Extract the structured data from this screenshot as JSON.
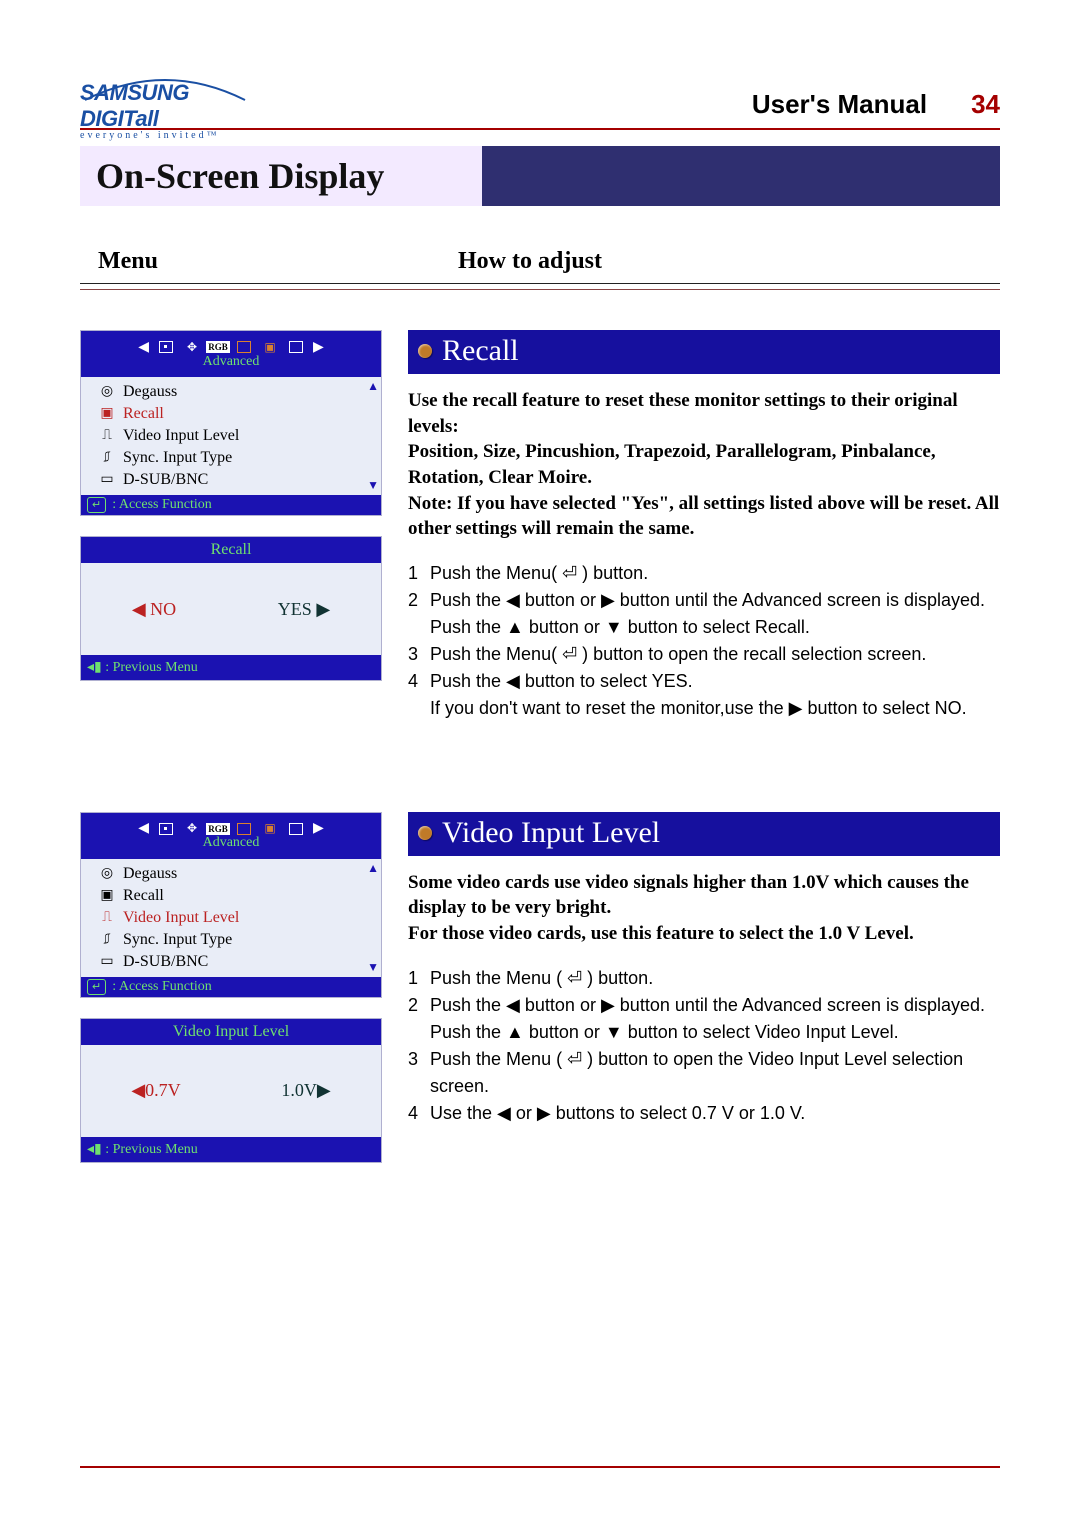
{
  "header": {
    "logo_main": "SAMSUNG DIGITall",
    "logo_tag": "everyone's invited™",
    "manual": "User's Manual",
    "page_no": "34"
  },
  "title": "On-Screen Display",
  "colheads": {
    "menu": "Menu",
    "howto": "How to adjust"
  },
  "osd_advanced_label": "Advanced",
  "osd_access_label": ": Access Function",
  "osd_prev_label": ": Previous Menu",
  "osd_items": [
    {
      "label": "Degauss"
    },
    {
      "label": "Recall"
    },
    {
      "label": "Video Input Level"
    },
    {
      "label": "Sync. Input Type"
    },
    {
      "label": "D-SUB/BNC"
    }
  ],
  "section1": {
    "heading": "Recall",
    "osd_selected_index": 1,
    "popup_title": "Recall",
    "popup_left": "NO",
    "popup_right": "YES",
    "desc_lines": [
      "Use the recall feature to reset these monitor settings to their original levels:",
      "Position, Size, Pincushion, Trapezoid, Parallelogram, Pinbalance, Rotation, Clear Moire.",
      "Note: If you have selected \"Yes\", all settings listed above will be reset. All other settings will remain the same."
    ],
    "steps": [
      {
        "n": "1",
        "t": "Push the Menu( ⏎ ) button."
      },
      {
        "n": "2",
        "t": "Push the ◀ button or ▶ button until the Advanced screen is displayed."
      },
      {
        "n": "",
        "t": "Push the ▲ button or ▼ button to select Recall."
      },
      {
        "n": "3",
        "t": "Push the Menu( ⏎ ) button to open the recall selection screen."
      },
      {
        "n": "4",
        "t": "Push the ◀ button to select YES."
      },
      {
        "n": "",
        "t": "If you don't want to reset the monitor,use the ▶ button to select NO."
      }
    ]
  },
  "section2": {
    "heading": "Video Input Level",
    "osd_selected_index": 2,
    "popup_title": "Video Input Level",
    "popup_left": "0.7V",
    "popup_right": "1.0V",
    "desc_lines": [
      "Some video cards use video signals higher than 1.0V which causes the display to be very bright.",
      "For those video cards, use this feature to select the 1.0 V Level."
    ],
    "steps": [
      {
        "n": "1",
        "t": "Push the Menu ( ⏎ ) button."
      },
      {
        "n": "2",
        "t": "Push the ◀ button or ▶ button until the Advanced screen is displayed."
      },
      {
        "n": "",
        "t": "Push the ▲ button or ▼ button to select Video Input Level."
      },
      {
        "n": "3",
        "t": "Push the Menu ( ⏎ ) button to open the Video Input Level selection screen."
      },
      {
        "n": "4",
        "t": "Use the ◀ or ▶ buttons to select 0.7 V or 1.0 V."
      }
    ]
  }
}
